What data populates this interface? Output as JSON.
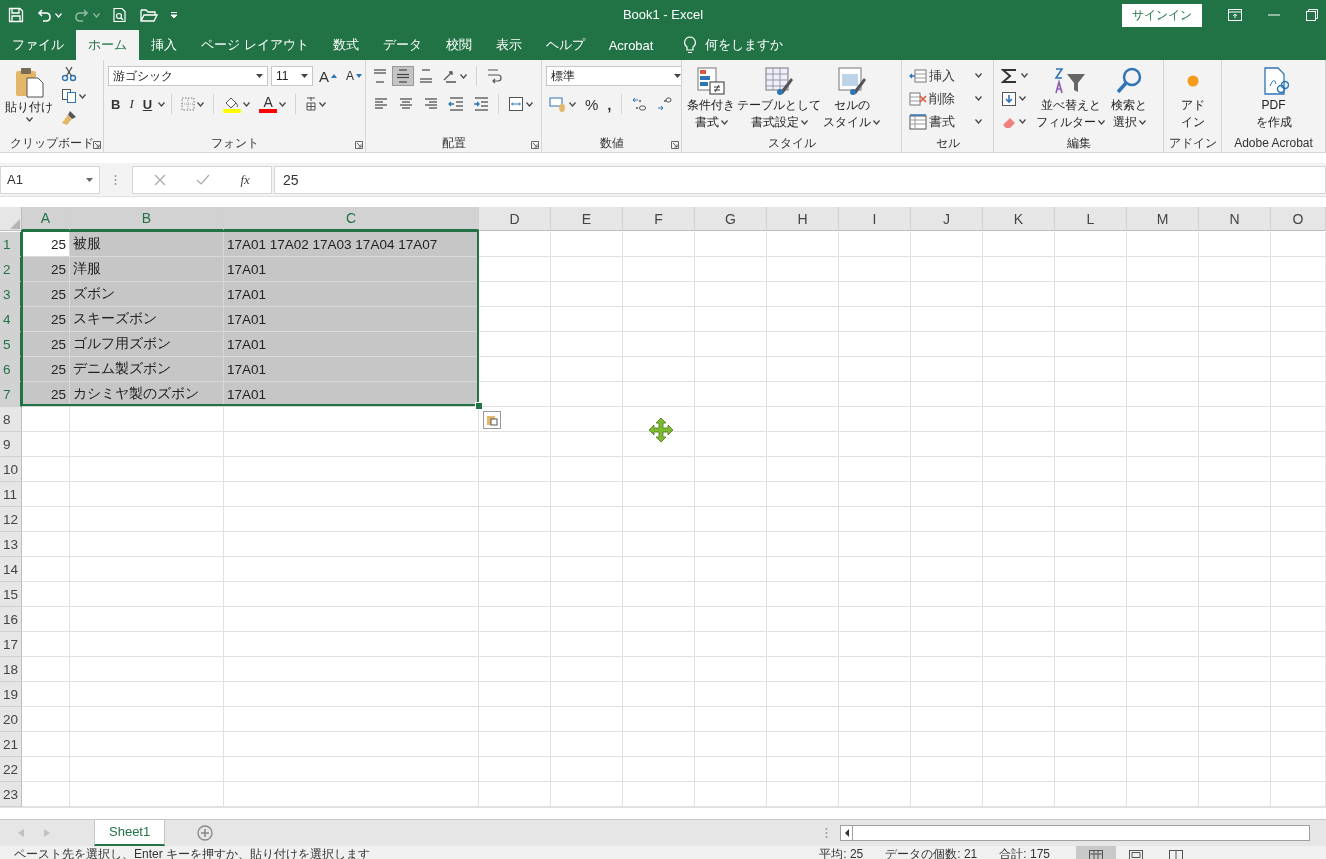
{
  "title_bar": {
    "title": "Book1  -  Excel",
    "sign_in": "サインイン"
  },
  "tabs": [
    {
      "label": "ファイル",
      "selected": false
    },
    {
      "label": "ホーム",
      "selected": true
    },
    {
      "label": "挿入",
      "selected": false
    },
    {
      "label": "ページ レイアウト",
      "selected": false
    },
    {
      "label": "数式",
      "selected": false
    },
    {
      "label": "データ",
      "selected": false
    },
    {
      "label": "校閲",
      "selected": false
    },
    {
      "label": "表示",
      "selected": false
    },
    {
      "label": "ヘルプ",
      "selected": false
    },
    {
      "label": "Acrobat",
      "selected": false
    }
  ],
  "tell_me": "何をしますか",
  "ribbon": [
    {
      "kind": "clipboard",
      "label": "クリップボード",
      "paste": "貼り付け"
    },
    {
      "kind": "font",
      "label": "フォント",
      "font": "游ゴシック",
      "size": "11",
      "grow": "A",
      "shrink": "A",
      "bold": "B",
      "italic": "I",
      "underline": "U",
      "font_color": "A"
    },
    {
      "kind": "alignment",
      "label": "配置",
      "vertical": [
        {
          "selected": false
        },
        {
          "selected": true
        },
        {
          "selected": false
        }
      ]
    },
    {
      "kind": "number",
      "label": "数値",
      "format": "標準",
      "percent": "%",
      "comma": ","
    },
    {
      "kind": "styles",
      "label": "スタイル",
      "buttons": [
        {
          "lines": [
            "条件付き",
            "書式"
          ],
          "menu": true
        },
        {
          "lines": [
            "テーブルとして",
            "書式設定"
          ],
          "menu": true
        },
        {
          "lines": [
            "セルの",
            "スタイル"
          ],
          "menu": true
        }
      ]
    },
    {
      "kind": "cells",
      "label": "セル",
      "buttons": [
        "挿入",
        "削除",
        "書式"
      ]
    },
    {
      "kind": "editing",
      "label": "編集",
      "buttons": [
        {
          "lines": [
            "並べ替えと",
            "フィルター"
          ],
          "menu": true
        },
        {
          "lines": [
            "検索と",
            "選択"
          ],
          "menu": true
        }
      ]
    },
    {
      "kind": "addins",
      "label": "アドイン",
      "buttons": [
        {
          "lines": [
            "アド",
            "イン"
          ],
          "menu": false
        }
      ]
    },
    {
      "kind": "acrobat",
      "label": "Adobe Acrobat",
      "buttons": [
        {
          "lines": [
            "PDF",
            "を作成"
          ],
          "menu": false
        }
      ]
    }
  ],
  "formula_bar": {
    "name_box": "A1",
    "fx": "fx",
    "value": "25"
  },
  "columns": [
    {
      "label": "A",
      "selected": true
    },
    {
      "label": "B",
      "selected": true
    },
    {
      "label": "C",
      "selected": true
    },
    {
      "label": "D",
      "selected": false
    },
    {
      "label": "E",
      "selected": false
    },
    {
      "label": "F",
      "selected": false
    },
    {
      "label": "G",
      "selected": false
    },
    {
      "label": "H",
      "selected": false
    },
    {
      "label": "I",
      "selected": false
    },
    {
      "label": "J",
      "selected": false
    },
    {
      "label": "K",
      "selected": false
    },
    {
      "label": "L",
      "selected": false
    },
    {
      "label": "M",
      "selected": false
    },
    {
      "label": "N",
      "selected": false
    },
    {
      "label": "O",
      "selected": false
    }
  ],
  "rows": [
    {
      "header": "1",
      "selected": true,
      "active": true,
      "cells": [
        "25",
        "被服",
        "17A01 17A02 17A03 17A04 17A07"
      ]
    },
    {
      "header": "2",
      "selected": true,
      "cells": [
        "25",
        "洋服",
        "17A01"
      ]
    },
    {
      "header": "3",
      "selected": true,
      "cells": [
        "25",
        "ズボン",
        "17A01"
      ]
    },
    {
      "header": "4",
      "selected": true,
      "cells": [
        "25",
        "スキーズボン",
        "17A01"
      ]
    },
    {
      "header": "5",
      "selected": true,
      "cells": [
        "25",
        "ゴルフ用ズボン",
        "17A01"
      ]
    },
    {
      "header": "6",
      "selected": true,
      "cells": [
        "25",
        "デニム製ズボン",
        "17A01"
      ]
    },
    {
      "header": "7",
      "selected": true,
      "cells": [
        "25",
        "カシミヤ製のズボン",
        "17A01"
      ]
    },
    {
      "header": "8",
      "selected": false
    },
    {
      "header": "9",
      "selected": false
    },
    {
      "header": "10",
      "selected": false
    },
    {
      "header": "11",
      "selected": false
    },
    {
      "header": "12",
      "selected": false
    },
    {
      "header": "13",
      "selected": false
    },
    {
      "header": "14",
      "selected": false
    },
    {
      "header": "15",
      "selected": false
    },
    {
      "header": "16",
      "selected": false
    },
    {
      "header": "17",
      "selected": false
    },
    {
      "header": "18",
      "selected": false
    },
    {
      "header": "19",
      "selected": false
    },
    {
      "header": "20",
      "selected": false
    },
    {
      "header": "21",
      "selected": false
    },
    {
      "header": "22",
      "selected": false
    },
    {
      "header": "23",
      "selected": false
    }
  ],
  "sheets": [
    {
      "label": "Sheet1",
      "selected": true
    }
  ],
  "status_bar": {
    "message": "ペースト先を選択し、Enter キーを押すか、貼り付けを選択します",
    "stats": [
      "平均: 25",
      "データの個数: 21",
      "合計: 175"
    ],
    "views": [
      {
        "selected": true
      },
      {
        "selected": false
      },
      {
        "selected": false
      }
    ]
  }
}
